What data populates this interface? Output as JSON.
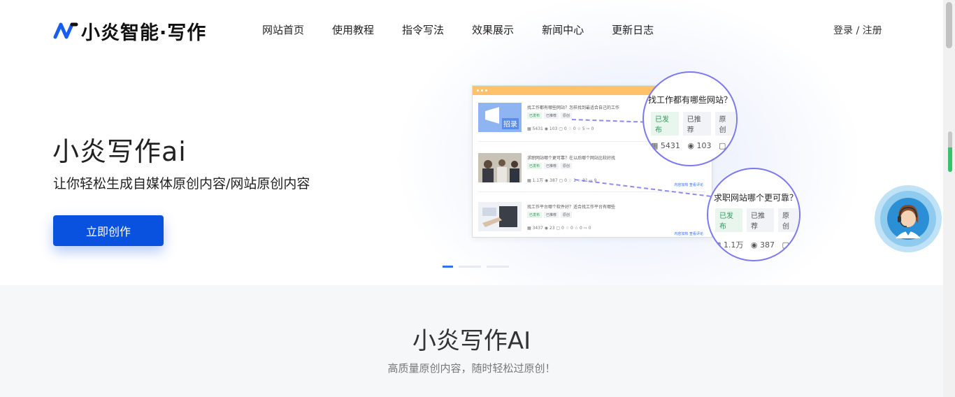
{
  "header": {
    "logo_text": "小炎智能·写作",
    "nav": [
      "网站首页",
      "使用教程",
      "指令写法",
      "效果展示",
      "新闻中心",
      "更新日志"
    ],
    "login": "登录 / 注册"
  },
  "hero": {
    "title": "小炎写作ai",
    "subtitle": "让你轻松生成自媒体原创内容/网站原创内容",
    "cta": "立即创作",
    "mock": {
      "rows": [
        {
          "title": "找工作都有哪些网站？怎样找到最适合自己的工作",
          "tags": [
            "已发布",
            "已推荐",
            "原创"
          ],
          "stats": "▦ 5431  ◉ 103  ▢ 0  ♢ 0  ☆ 5  ⇨ 0",
          "links": ""
        },
        {
          "title": "求职网站哪个更可靠？在以后哪个网站比较好找",
          "tags": [
            "已发布",
            "已推荐",
            "原创"
          ],
          "stats": "▦ 1.1万  ◉ 387  ▢ 0  ♢ 1  ☆ 31  ⇨ 9",
          "links": "内容加热  查看评论"
        },
        {
          "title": "找工作平台哪个软件好？适合找工作平台有哪些",
          "tags": [
            "已发布",
            "已推荐",
            "原创"
          ],
          "stats": "▦ 3437  ◉ 23  ▢ 0  ♢ 0  ☆ 0  ⇨ 0",
          "links": "内容加热  查看评论"
        }
      ]
    },
    "zoom1": {
      "title": "找工作都有哪些网站？",
      "tags": [
        "已发布",
        "已推荐",
        "原创"
      ],
      "views": "5431",
      "reads": "103"
    },
    "zoom2": {
      "title": "求职网站哪个更可靠？",
      "tags": [
        "已发布",
        "已推荐",
        "原创"
      ],
      "views": "1.1万",
      "reads": "387"
    },
    "carousel_active_index": 0
  },
  "section2": {
    "title": "小炎写作AI",
    "subtitle": "高质量原创内容，随时轻松过原创！"
  },
  "colors": {
    "primary": "#0952e0",
    "accent_line": "#7c79f0",
    "mock_header": "#ffc26b"
  }
}
